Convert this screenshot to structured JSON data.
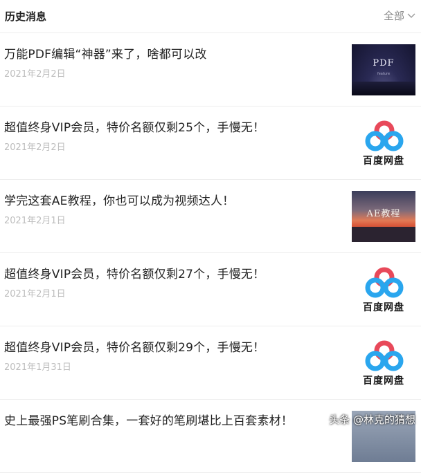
{
  "header": {
    "title": "历史消息",
    "filter_label": "全部"
  },
  "articles": [
    {
      "title": "万能PDF编辑“神器”来了，啥都可以改",
      "date": "2021年2月2日",
      "thumb": "pdf",
      "thumb_label": "PDF",
      "thumb_sub": "feature"
    },
    {
      "title": "超值终身VIP会员，特价名额仅剩25个，手慢无！",
      "date": "2021年2月2日",
      "thumb": "baidu",
      "thumb_label": "百度网盘"
    },
    {
      "title": "学完这套AE教程，你也可以成为视频达人！",
      "date": "2021年2月1日",
      "thumb": "ae",
      "thumb_label": "AE教程"
    },
    {
      "title": "超值终身VIP会员，特价名额仅剩27个，手慢无！",
      "date": "2021年2月1日",
      "thumb": "baidu",
      "thumb_label": "百度网盘"
    },
    {
      "title": "超值终身VIP会员，特价名额仅剩29个，手慢无！",
      "date": "2021年1月31日",
      "thumb": "baidu",
      "thumb_label": "百度网盘"
    },
    {
      "title": "史上最强PS笔刷合集，一套好的笔刷堪比上百套素材！",
      "date": "",
      "thumb": "ps",
      "thumb_label": ""
    }
  ],
  "watermark": "头条 @林克的猜想",
  "colors": {
    "baidu_red": "#e8495a",
    "baidu_blue": "#2aa6ee",
    "date_gray": "#bdbdbd",
    "divider": "#ededed"
  },
  "icons": {
    "filter": "chevron-down-icon",
    "baidu": "baidu-netdisk-logo"
  }
}
